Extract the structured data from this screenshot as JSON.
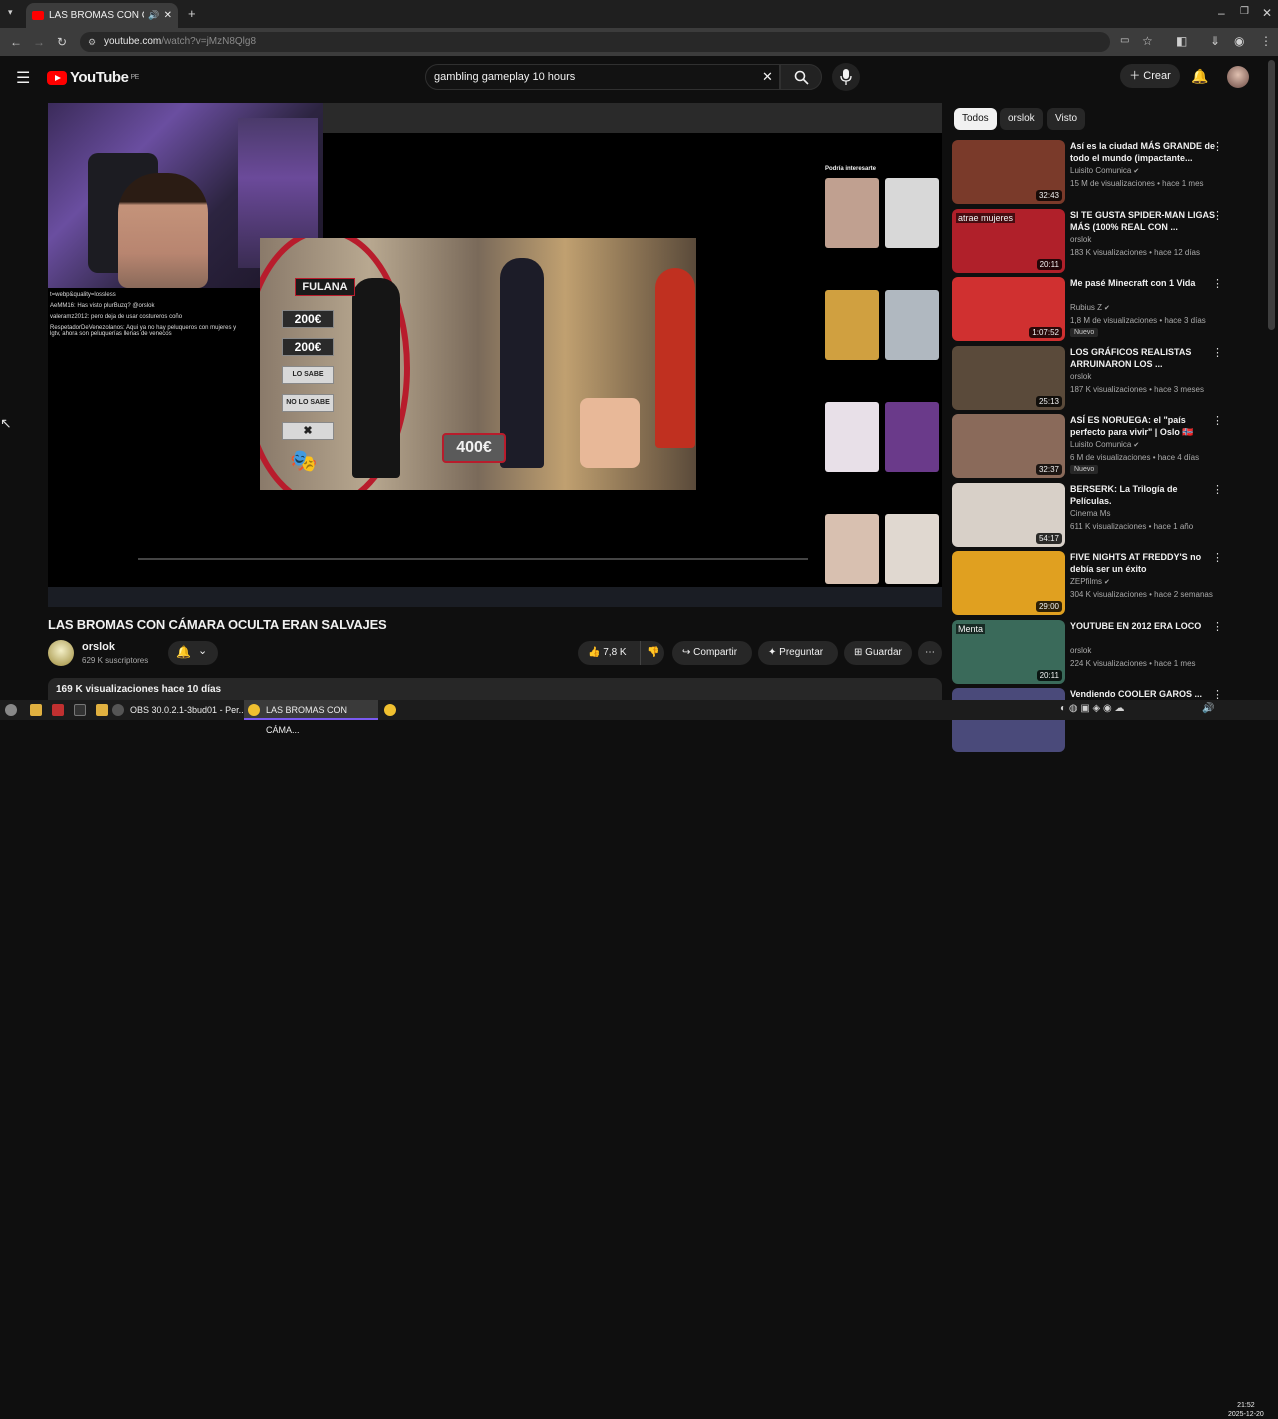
{
  "browser": {
    "tab_title": "LAS BROMAS CON CÁMARA OCULTA ERAN SALVAJES - YouTube",
    "url_host": "youtube.com",
    "url_path": "/watch?v=jMzN8Qlg8"
  },
  "header": {
    "logo_text": "YouTube",
    "logo_region": "PE",
    "search_value": "gambling gameplay 10 hours",
    "create_label": "Crear"
  },
  "video": {
    "title": "LAS BROMAS CON CÁMARA OCULTA ERAN SALVAJES",
    "channel": "orslok",
    "subscribers": "629 K suscriptores",
    "like_count": "7,8 K",
    "share_label": "Compartir",
    "ask_label": "Preguntar",
    "save_label": "Guardar",
    "description_stats": "169 K visualizaciones  hace 10 días"
  },
  "player_overlay": {
    "fulana": "FULANA",
    "price1": "200€",
    "price2": "200€",
    "lo_sabe": "LO SABE",
    "no_lo_sabe": "NO LO SABE",
    "prize": "400€",
    "chat": [
      "t=webp&quality=lossless",
      "AeMM16: Has visto plurBuzq? @orslok",
      "valeramz2012: pero deja de usar costureros coño",
      "RespetadorDeVenezolanos: Aqui ya no hay peluqueros con mujeres y lgtv, ahora son peluquerías llenas de venecos"
    ],
    "inner_sidebar_title": "Podría interesarte"
  },
  "chips": [
    "Todos",
    "orslok",
    "Visto"
  ],
  "recommendations": [
    {
      "title": "Así es la ciudad MÁS GRANDE de todo el mundo (impactante...",
      "channel": "Luisito Comunica",
      "verified": true,
      "meta": "15 M de visualizaciones • hace 1 mes",
      "duration": "32:43",
      "badge": "",
      "thumb_color": "#7a3a2a"
    },
    {
      "title": "SI TE GUSTA SPIDER-MAN LIGAS MÁS (100% REAL CON ...",
      "channel": "orslok",
      "verified": false,
      "meta": "183 K visualizaciones • hace 12 días",
      "duration": "20:11",
      "badge": "",
      "thumb_color": "#b0202a",
      "thumb_text": "atrae mujeres"
    },
    {
      "title": "Me pasé Minecraft con 1 Vida",
      "channel": "Rubius Z",
      "verified": true,
      "meta": "1,8 M de visualizaciones • hace 3 días",
      "duration": "1:07:52",
      "badge": "Nuevo",
      "thumb_color": "#d03030"
    },
    {
      "title": "LOS GRÁFICOS REALISTAS ARRUINARON LOS ...",
      "channel": "orslok",
      "verified": false,
      "meta": "187 K visualizaciones • hace 3 meses",
      "duration": "25:13",
      "badge": "",
      "thumb_color": "#5a4a3a"
    },
    {
      "title": "ASÍ ES NORUEGA: el \"país perfecto para vivir\" | Oslo 🇳🇴",
      "channel": "Luisito Comunica",
      "verified": true,
      "meta": "6 M de visualizaciones • hace 4 días",
      "duration": "32:37",
      "badge": "Nuevo",
      "thumb_color": "#8a6a5a"
    },
    {
      "title": "BERSERK: La Trilogía de Películas.",
      "channel": "Cinema Ms",
      "verified": false,
      "meta": "611 K visualizaciones • hace 1 año",
      "duration": "54:17",
      "badge": "",
      "thumb_color": "#d8d0c8"
    },
    {
      "title": "FIVE NIGHTS AT FREDDY'S no debía ser un éxito",
      "channel": "ZEPfilms",
      "verified": true,
      "meta": "304 K visualizaciones • hace 2 semanas",
      "duration": "29:00",
      "badge": "",
      "thumb_color": "#e0a020"
    },
    {
      "title": "YOUTUBE EN 2012 ERA LOCO",
      "channel": "orslok",
      "verified": false,
      "meta": "224 K visualizaciones • hace 1 mes",
      "duration": "20:11",
      "badge": "",
      "thumb_color": "#3a6a5a",
      "thumb_text": "Menta"
    },
    {
      "title": "Vendiendo COOLER GAROS ...",
      "channel": "",
      "verified": false,
      "meta": "",
      "duration": "",
      "badge": "",
      "thumb_color": "#4a4a7a"
    }
  ],
  "taskbar": {
    "obs_label": "OBS 30.0.2.1-3bud01 - Per...",
    "browser_label": "LAS BROMAS CON CÁMA...",
    "time": "21:52",
    "date": "2025-12-20"
  }
}
